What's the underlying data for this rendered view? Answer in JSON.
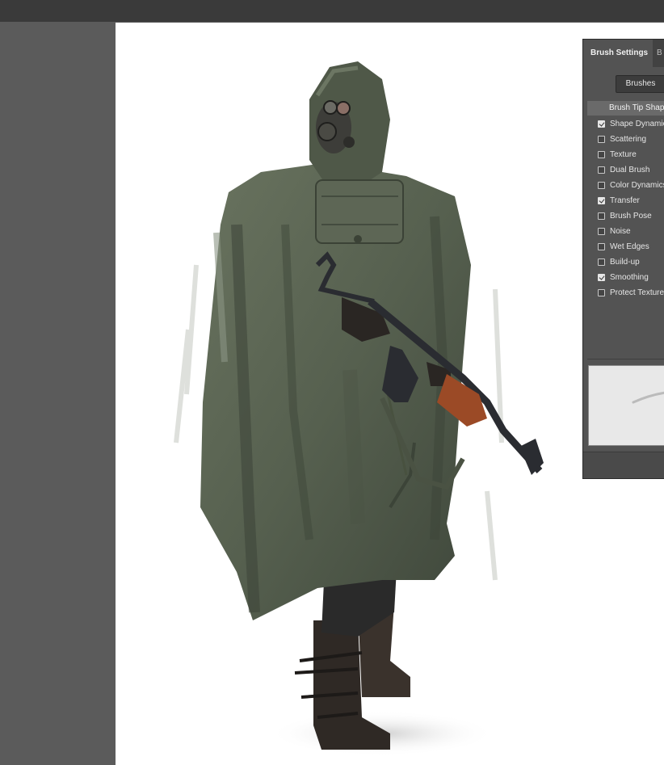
{
  "panel": {
    "active_tab": "Brush Settings",
    "next_tab_partial": "B",
    "brushes_button": "Brushes",
    "tip_shape_label": "Brush Tip Shape",
    "options": [
      {
        "label": "Shape Dynamics",
        "checked": true
      },
      {
        "label": "Scattering",
        "checked": false
      },
      {
        "label": "Texture",
        "checked": false
      },
      {
        "label": "Dual Brush",
        "checked": false
      },
      {
        "label": "Color Dynamics",
        "checked": false
      },
      {
        "label": "Transfer",
        "checked": true
      },
      {
        "label": "Brush Pose",
        "checked": false
      },
      {
        "label": "Noise",
        "checked": false
      },
      {
        "label": "Wet Edges",
        "checked": false
      },
      {
        "label": "Build-up",
        "checked": false
      },
      {
        "label": "Smoothing",
        "checked": true
      },
      {
        "label": "Protect Texture",
        "checked": false
      }
    ]
  },
  "colors": {
    "cloak": "#56604f",
    "cloak_shadow": "#3c4438",
    "cloak_highlight": "#7d8776",
    "boots": "#2f2925",
    "gun_wood": "#9b4a26",
    "gun_metal": "#2a2c31",
    "mask": "#3d3d39"
  }
}
